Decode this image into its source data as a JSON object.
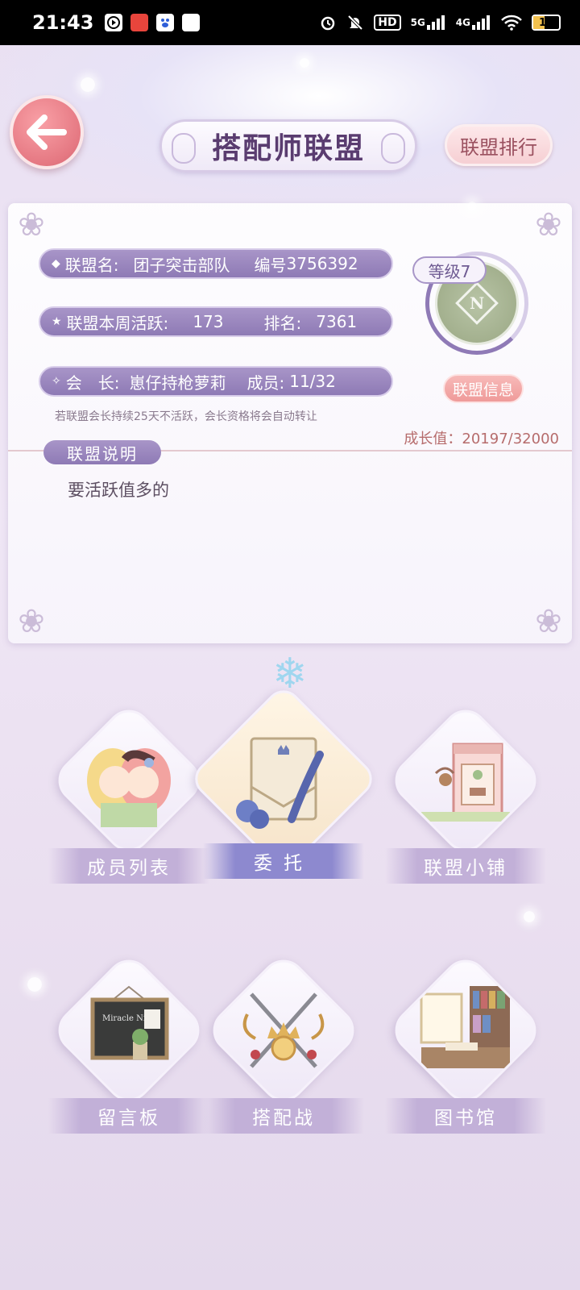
{
  "status_bar": {
    "time": "21:43",
    "battery": "19",
    "network_5g": "5G",
    "network_4g": "4G",
    "hd": "HD"
  },
  "header": {
    "title": "搭配师联盟",
    "rank_button": "联盟排行"
  },
  "union": {
    "name_label": "联盟名:",
    "name": "团子突击部队",
    "id_label": "编号",
    "id": "3756392",
    "level": "等级7",
    "weekly_active_label": "联盟本周活跃:",
    "weekly_active": "173",
    "rank_label": "排名:",
    "rank": "7361",
    "leader_label": "会　长:",
    "leader": "崽仔持枪萝莉",
    "members_label": "成员:",
    "members": "11/32",
    "info_button": "联盟信息",
    "hint": "若联盟会长持续25天不活跃，会长资格将会自动转让",
    "growth": "成长值：20197/32000",
    "desc_tag": "联盟说明",
    "description": "要活跃值多的",
    "emblem_letter": "N"
  },
  "menu": {
    "members_list": "成员列表",
    "commission": "委托",
    "shop": "联盟小铺",
    "message_board": "留言板",
    "battle": "搭配战",
    "library": "图书馆"
  },
  "chalkboard_text": "Miracle Nikki",
  "colors": {
    "accent_purple": "#8e7ab5",
    "accent_pink": "#e57882",
    "growth_text": "#b66c6c"
  }
}
